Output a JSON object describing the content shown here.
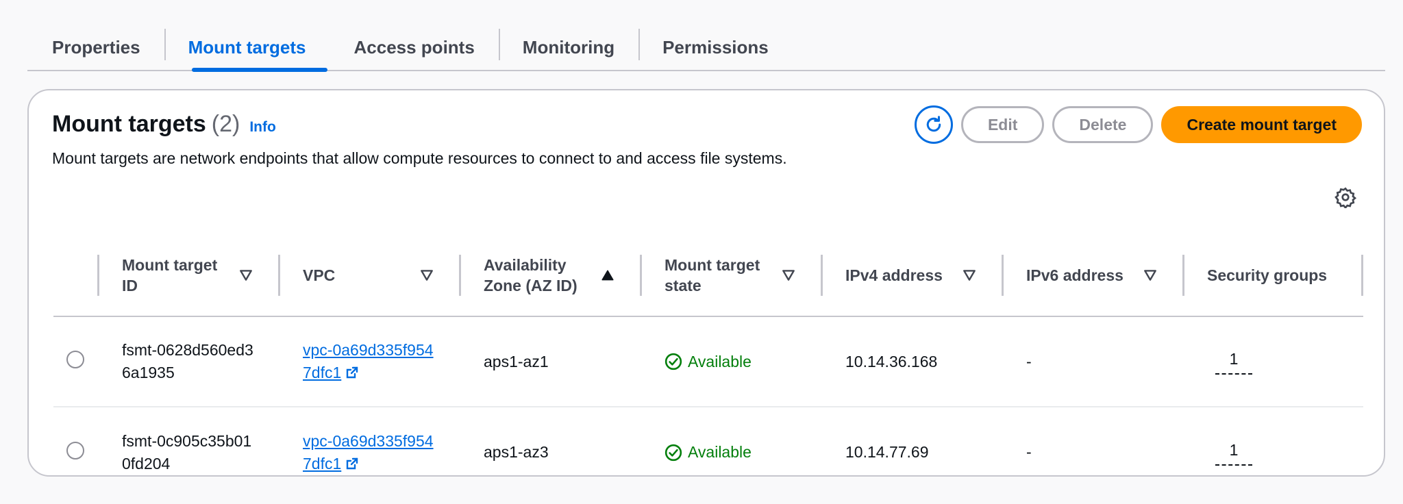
{
  "tabs": [
    {
      "label": "Properties",
      "active": false
    },
    {
      "label": "Mount targets",
      "active": true
    },
    {
      "label": "Access points",
      "active": false
    },
    {
      "label": "Monitoring",
      "active": false
    },
    {
      "label": "Permissions",
      "active": false
    }
  ],
  "panel": {
    "title": "Mount targets",
    "count": "(2)",
    "info_label": "Info",
    "description": "Mount targets are network endpoints that allow compute resources to connect to and access file systems.",
    "edit_label": "Edit",
    "delete_label": "Delete",
    "create_label": "Create mount target"
  },
  "table": {
    "headers": [
      {
        "label": "Mount target ID",
        "sort": "desc"
      },
      {
        "label": "VPC",
        "sort": "desc"
      },
      {
        "label": "Availability Zone (AZ ID)",
        "sort": "asc"
      },
      {
        "label": "Mount target state",
        "sort": "desc"
      },
      {
        "label": "IPv4 address",
        "sort": "desc"
      },
      {
        "label": "IPv6 address",
        "sort": "desc"
      },
      {
        "label": "Security groups",
        "sort": "none"
      }
    ],
    "rows": [
      {
        "id": "fsmt-0628d560ed36a1935",
        "vpc": "vpc-0a69d335f9547dfc1",
        "az": "aps1-az1",
        "state": "Available",
        "ipv4": "10.14.36.168",
        "ipv6": "-",
        "security_groups": "1"
      },
      {
        "id": "fsmt-0c905c35b010fd204",
        "vpc": "vpc-0a69d335f9547dfc1",
        "az": "aps1-az3",
        "state": "Available",
        "ipv4": "10.14.77.69",
        "ipv6": "-",
        "security_groups": "1"
      }
    ]
  },
  "colors": {
    "accent": "#006ce0",
    "primary_button": "#ff9900",
    "success": "#037f0c"
  }
}
